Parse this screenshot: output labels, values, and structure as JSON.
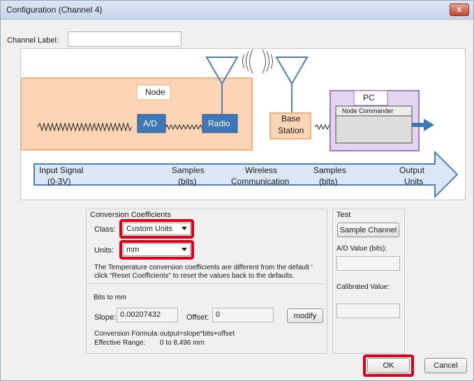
{
  "window": {
    "title": "Configuration (Channel 4)",
    "close_glyph": "x"
  },
  "channel_label": {
    "label": "Channel Label:",
    "value": ""
  },
  "diagram": {
    "node": "Node",
    "ad": "A/D",
    "radio": "Radio",
    "base_station_line1": "Base",
    "base_station_line2": "Station",
    "pc": "PC",
    "node_commander": "Node Commander",
    "arrow_labels": {
      "input_line1": "Input  Signal",
      "input_line2": "(0-3V)",
      "samples_line1": "Samples",
      "samples_line2": "(bits)",
      "wireless_line1": "Wireless",
      "wireless_line2": "Communication",
      "samples2_line1": "Samples",
      "samples2_line2": "(bits)",
      "output_line1": "Output",
      "output_line2": "Units"
    },
    "colors": {
      "node_fill": "#fbd5b5",
      "node_border": "#f5b17c",
      "blue": "#3d77b8",
      "base_fill": "#fbd5b5",
      "pc_fill": "#e3d5ef",
      "pc_border": "#9f7cc7",
      "arrow_fill": "#dbe7f5",
      "arrow_border": "#4f7fb8"
    }
  },
  "conversion": {
    "group_title": "Conversion Coefficients",
    "class_label": "Class:",
    "class_value": "Custom Units",
    "units_label": "Units:",
    "units_value": "mm",
    "notice_line1": "The Temperature conversion coefficients are different from the default ‘",
    "notice_line2": "click “Reset Coefficients” to reset the values back to the defaults.",
    "bits_title": "Bits to mm",
    "slope_label": "Slope:",
    "slope_value": "0.00207432",
    "offset_label": "Offset:",
    "offset_value": "0",
    "modify_label": "modify",
    "formula_label": "Conversion Formula:",
    "formula_value": "output=slope*bits+offset",
    "range_label": "Effective Range:",
    "range_value": "0 to 8.496 mm"
  },
  "test": {
    "title": "Test",
    "sample_button": "Sample Channel",
    "ad_label": "A/D Value (bits):",
    "ad_value": "",
    "calibrated_label": "Calibrated Value:",
    "calibrated_value": ""
  },
  "footer": {
    "ok_label": "OK",
    "cancel_label": "Cancel"
  },
  "highlight_color": "#d9001b"
}
